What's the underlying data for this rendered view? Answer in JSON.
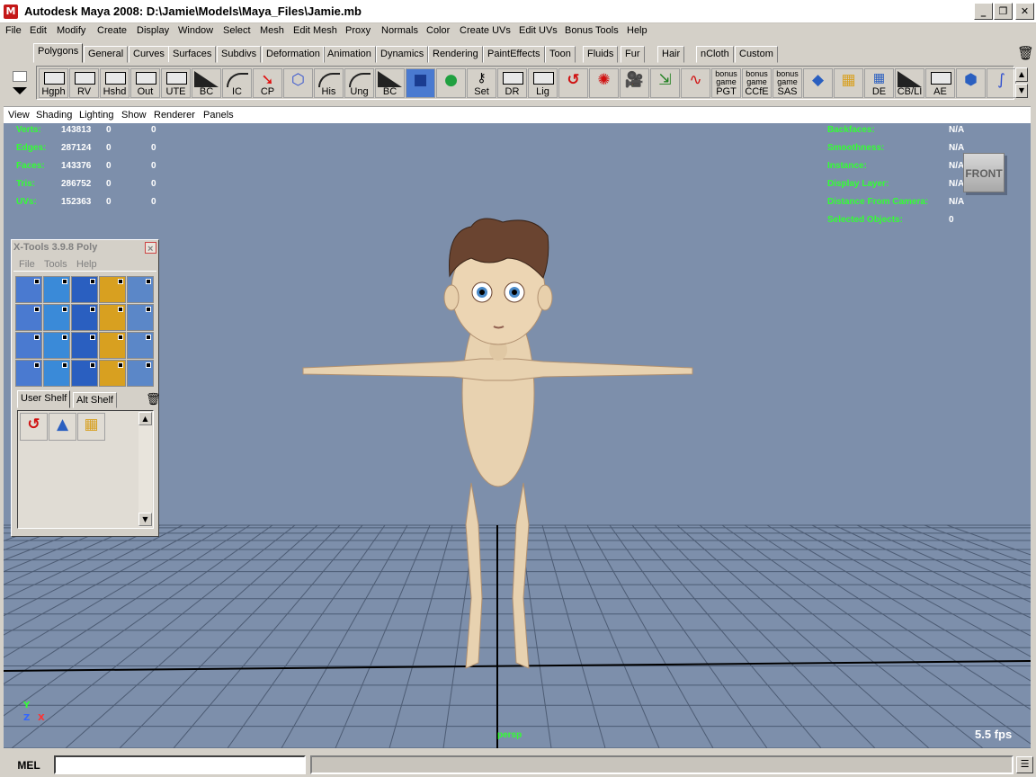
{
  "window": {
    "title": "Autodesk Maya 2008: D:\\Jamie\\Models\\Maya_Files\\Jamie.mb",
    "app_icon": "maya-logo-icon",
    "controls": [
      "minimize-icon",
      "restore-icon",
      "close-icon"
    ]
  },
  "menubar": {
    "items": [
      "File",
      "Edit",
      "Modify",
      "Create",
      "Display",
      "Window",
      "Select",
      "Mesh",
      "Edit Mesh",
      "Proxy",
      "Normals",
      "Color",
      "Create UVs",
      "Edit UVs",
      "Bonus Tools",
      "Help"
    ]
  },
  "shelf_tabs": {
    "items": [
      "Polygons",
      "General",
      "Curves",
      "Surfaces",
      "Subdivs",
      "Deformation",
      "Animation",
      "Dynamics",
      "Rendering",
      "PaintEffects",
      "Toon",
      "Fluids",
      "Fur",
      "Hair",
      "nCloth",
      "Custom"
    ],
    "active": "Polygons"
  },
  "shelf": {
    "buttons": [
      {
        "label": "Hgph",
        "icon": "hypergraph-box-icon"
      },
      {
        "label": "RV",
        "icon": "render-view-box-icon"
      },
      {
        "label": "Hshd",
        "icon": "hypershade-box-icon"
      },
      {
        "label": "Out",
        "icon": "outliner-box-icon"
      },
      {
        "label": "UTE",
        "icon": "uv-texture-editor-box-icon"
      },
      {
        "label": "BC",
        "icon": "triangle-black-icon"
      },
      {
        "label": "IC",
        "icon": "curve-icon"
      },
      {
        "label": "CP",
        "icon": "red-arrow-icon"
      },
      {
        "label": "",
        "icon": "wire-cube-icon"
      },
      {
        "label": "His",
        "icon": "curve-icon"
      },
      {
        "label": "Ung",
        "icon": "curve-icon"
      },
      {
        "label": "BC",
        "icon": "triangle-black-icon"
      },
      {
        "label": "",
        "icon": "blue-box-icon"
      },
      {
        "label": "",
        "icon": "colored-spheres-icon"
      },
      {
        "label": "Set",
        "icon": "key-icon"
      },
      {
        "label": "DR",
        "icon": "box-icon"
      },
      {
        "label": "Lig",
        "icon": "box-icon"
      },
      {
        "label": "",
        "icon": "red-undo-arrow-icon"
      },
      {
        "label": "",
        "icon": "red-splash-icon"
      },
      {
        "label": "",
        "icon": "camera-icon"
      },
      {
        "label": "",
        "icon": "xyz-axes-icon"
      },
      {
        "label": "",
        "icon": "red-curve-icon"
      },
      {
        "label": "PGT",
        "top": "bonus game",
        "icon": "bonus-game-icon"
      },
      {
        "label": "CCfE",
        "top": "bonus game",
        "icon": "bonus-game-icon"
      },
      {
        "label": "SAS",
        "top": "bonus game",
        "icon": "bonus-game-icon"
      },
      {
        "label": "",
        "icon": "blue-plane-icon"
      },
      {
        "label": "",
        "icon": "uv-grid-icon"
      },
      {
        "label": "DE",
        "icon": "blue-grid-icon"
      },
      {
        "label": "CB/LI",
        "icon": "triangle-black-icon"
      },
      {
        "label": "AE",
        "icon": "box-icon"
      },
      {
        "label": "",
        "icon": "blue-cylinder-icon"
      },
      {
        "label": "",
        "icon": "select-curve-icon"
      }
    ]
  },
  "panel_menu": {
    "items": [
      "View",
      "Shading",
      "Lighting",
      "Show",
      "Renderer",
      "Panels"
    ]
  },
  "hud_left": {
    "rows": [
      {
        "label": "Verts:",
        "a": "143813",
        "b": "0",
        "c": "0"
      },
      {
        "label": "Edges:",
        "a": "287124",
        "b": "0",
        "c": "0"
      },
      {
        "label": "Faces:",
        "a": "143376",
        "b": "0",
        "c": "0"
      },
      {
        "label": "Tris:",
        "a": "286752",
        "b": "0",
        "c": "0"
      },
      {
        "label": "UVs:",
        "a": "152363",
        "b": "0",
        "c": "0"
      }
    ]
  },
  "hud_right": {
    "rows": [
      {
        "label": "Backfaces:",
        "value": "N/A"
      },
      {
        "label": "Smoothness:",
        "value": "N/A"
      },
      {
        "label": "Instance:",
        "value": "N/A"
      },
      {
        "label": "Display Layer:",
        "value": "N/A"
      },
      {
        "label": "Distance From Camera:",
        "value": "N/A"
      },
      {
        "label": "Selected Objects:",
        "value": "0"
      }
    ]
  },
  "viewport": {
    "view_cube": "FRONT",
    "camera": "persp",
    "fps": "5.5 fps",
    "axes": {
      "y": "Y",
      "z": "Z",
      "x": "X"
    },
    "background": "#7d8fab"
  },
  "xtools": {
    "title": "X-Tools 3.9.8 Poly",
    "close": "×",
    "menu": [
      "File",
      "Tools",
      "Help"
    ],
    "tabs": [
      "User Shelf",
      "Alt Shelf"
    ],
    "active_tab": "User Shelf",
    "tool_count": 20,
    "user_shelf_icons": [
      "red-undo-arrow-icon",
      "blue-cone-icon",
      "uv-grid-icon"
    ]
  },
  "commandline": {
    "label": "MEL",
    "value": "",
    "result": ""
  }
}
